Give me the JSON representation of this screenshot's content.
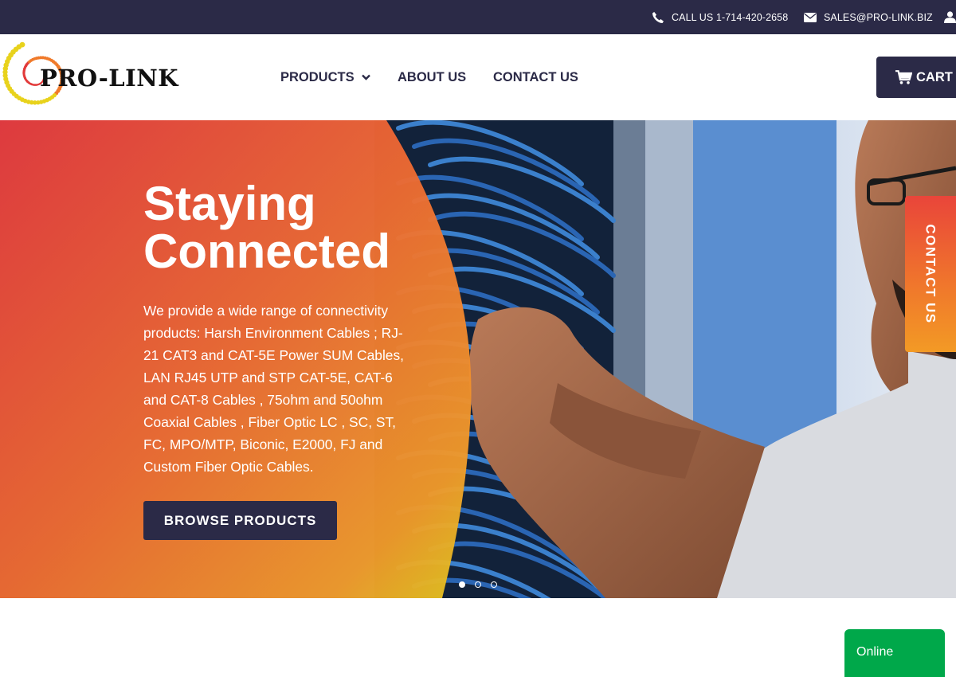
{
  "topbar": {
    "phone": "CALL US 1-714-420-2658",
    "email": "SALES@PRO-LINK.BIZ"
  },
  "header": {
    "logo_text": "PRO-LINK",
    "nav": {
      "products": "PRODUCTS",
      "about": "ABOUT US",
      "contact": "CONTACT US"
    },
    "cart_label": "CART ("
  },
  "hero": {
    "title_line1": "Staying",
    "title_line2": "Connected",
    "description": "We provide a wide range of connectivity products: Harsh Environment Cables ; RJ-21 CAT3 and CAT-5E Power SUM Cables, LAN RJ45 UTP and STP CAT-5E, CAT-6 and CAT-8 Cables , 75ohm and 50ohm Coaxial Cables , Fiber Optic LC , SC, ST, FC, MPO/MTP, Biconic, E2000, FJ and Custom Fiber Optic Cables.",
    "button": "BROWSE PRODUCTS",
    "slides": 3,
    "active_slide": 1
  },
  "side_tab": "CONTACT US",
  "chat": "Online",
  "colors": {
    "navy": "#2b2a47",
    "orange": "#f0792b",
    "red": "#e63b3f",
    "green": "#00a84a"
  }
}
